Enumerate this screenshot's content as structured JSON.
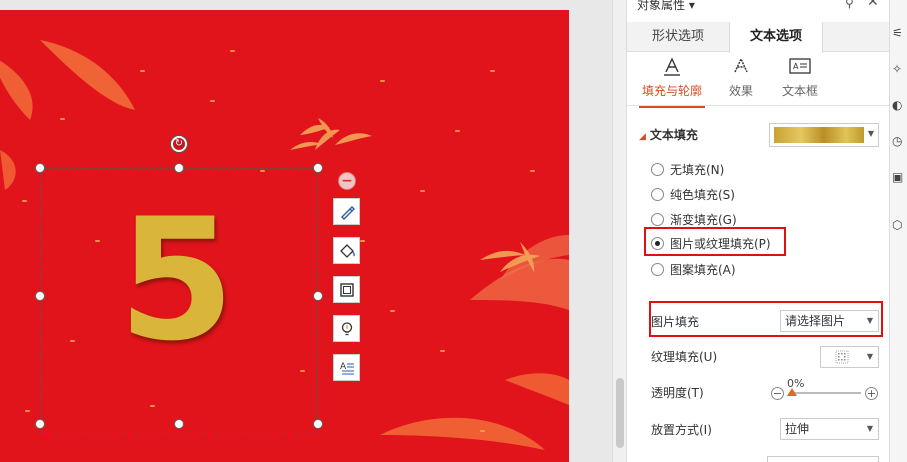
{
  "pane": {
    "title": "对象属性 ▾",
    "tabs": [
      "形状选项",
      "文本选项"
    ],
    "subtabs": [
      "填充与轮廓",
      "效果",
      "文本框"
    ],
    "section_title": "文本填充",
    "fill_options": [
      "无填充(N)",
      "纯色填充(S)",
      "渐变填充(G)",
      "图片或纹理填充(P)",
      "图案填充(A)"
    ],
    "selected_fill": "图片或纹理填充(P)",
    "picture_fill_label": "图片填充",
    "picture_fill_value": "请选择图片",
    "texture_fill_label": "纹理填充(U)",
    "transparency_label": "透明度(T)",
    "transparency_value": "0%",
    "placement_label": "放置方式(I)",
    "placement_value": "拉伸"
  },
  "slide": {
    "big_text": "5"
  },
  "colors": {
    "slide_bg": "#e0141a",
    "accent": "#d94b20",
    "highlight_box": "#e01010",
    "gold": "#d9b53a"
  }
}
